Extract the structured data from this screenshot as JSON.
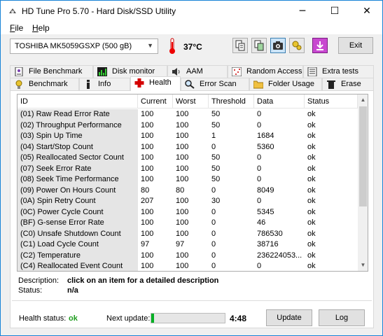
{
  "window": {
    "title": "HD Tune Pro 5.70 - Hard Disk/SSD Utility",
    "min": "─",
    "max": "☐",
    "close": "✕"
  },
  "menu": {
    "file": "File",
    "help": "Help"
  },
  "toolbar": {
    "drive": "TOSHIBA MK5059GSXP (500 gB)",
    "temperature": "37°C",
    "exit_label": "Exit",
    "buttons": [
      "copy-icon",
      "copy-screenshot-icon",
      "camera-icon",
      "options-icon",
      "download-icon"
    ]
  },
  "tabs_row1": [
    {
      "label": "File Benchmark",
      "icon": "file-benchmark-icon"
    },
    {
      "label": "Disk monitor",
      "icon": "disk-monitor-icon"
    },
    {
      "label": "AAM",
      "icon": "speaker-icon"
    },
    {
      "label": "Random Access",
      "icon": "random-access-icon"
    },
    {
      "label": "Extra tests",
      "icon": "extra-tests-icon"
    }
  ],
  "tabs_row2": [
    {
      "label": "Benchmark",
      "icon": "benchmark-icon"
    },
    {
      "label": "Info",
      "icon": "info-icon"
    },
    {
      "label": "Health",
      "icon": "health-cross-icon"
    },
    {
      "label": "Error Scan",
      "icon": "magnifier-icon"
    },
    {
      "label": "Folder Usage",
      "icon": "folder-icon"
    },
    {
      "label": "Erase",
      "icon": "trash-icon"
    }
  ],
  "selected_tab": "Health",
  "table": {
    "headers": [
      "ID",
      "Current",
      "Worst",
      "Threshold",
      "Data",
      "Status"
    ],
    "rows": [
      [
        "(01) Raw Read Error Rate",
        "100",
        "100",
        "50",
        "0",
        "ok"
      ],
      [
        "(02) Throughput Performance",
        "100",
        "100",
        "50",
        "0",
        "ok"
      ],
      [
        "(03) Spin Up Time",
        "100",
        "100",
        "1",
        "1684",
        "ok"
      ],
      [
        "(04) Start/Stop Count",
        "100",
        "100",
        "0",
        "5360",
        "ok"
      ],
      [
        "(05) Reallocated Sector Count",
        "100",
        "100",
        "50",
        "0",
        "ok"
      ],
      [
        "(07) Seek Error Rate",
        "100",
        "100",
        "50",
        "0",
        "ok"
      ],
      [
        "(08) Seek Time Performance",
        "100",
        "100",
        "50",
        "0",
        "ok"
      ],
      [
        "(09) Power On Hours Count",
        "80",
        "80",
        "0",
        "8049",
        "ok"
      ],
      [
        "(0A) Spin Retry Count",
        "207",
        "100",
        "30",
        "0",
        "ok"
      ],
      [
        "(0C) Power Cycle Count",
        "100",
        "100",
        "0",
        "5345",
        "ok"
      ],
      [
        "(BF) G-sense Error Rate",
        "100",
        "100",
        "0",
        "46",
        "ok"
      ],
      [
        "(C0) Unsafe Shutdown Count",
        "100",
        "100",
        "0",
        "786530",
        "ok"
      ],
      [
        "(C1) Load Cycle Count",
        "97",
        "97",
        "0",
        "38716",
        "ok"
      ],
      [
        "(C2) Temperature",
        "100",
        "100",
        "0",
        "236224053...",
        "ok"
      ],
      [
        "(C4) Reallocated Event Count",
        "100",
        "100",
        "0",
        "0",
        "ok"
      ]
    ]
  },
  "description": {
    "label": "Description:",
    "value": "click on an item for a detailed description",
    "status_label": "Status:",
    "status_value": "n/a"
  },
  "footer": {
    "health_label": "Health status:",
    "health_value": "ok",
    "next_update_label": "Next update:",
    "next_update_progress": 0.04,
    "countdown": "4:48",
    "update_label": "Update",
    "log_label": "Log"
  },
  "colors": {
    "ok_green": "#1e9c1e",
    "progress_green": "#06b025",
    "accent_blue": "#1883d7"
  }
}
